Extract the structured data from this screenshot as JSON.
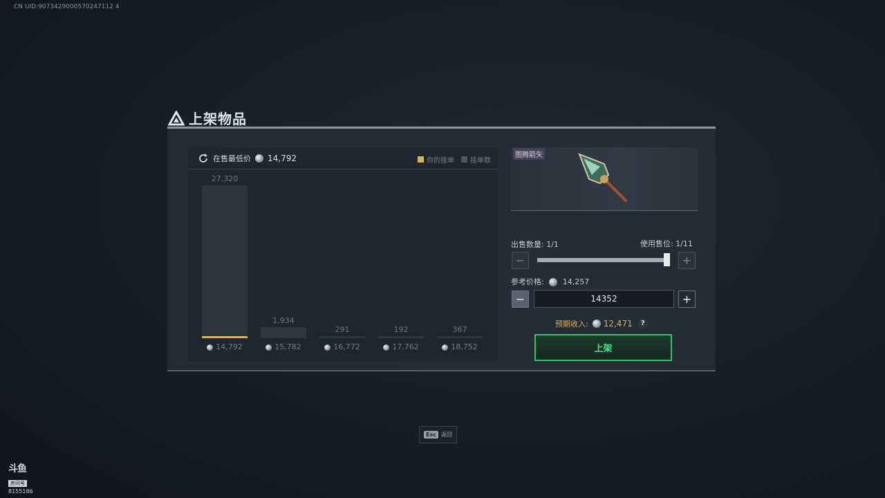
{
  "uid": "CN UID:9073429000570247112 4",
  "dialog": {
    "title": "上架物品",
    "chart": {
      "lowest_label": "在售最低价",
      "lowest_price": "14,792",
      "legend_mine": "你的挂单",
      "legend_count": "挂单数"
    },
    "item": {
      "name": "图腾箭矢",
      "icon": "arrow-icon"
    },
    "quantity_label": "出售数量:",
    "quantity_value": "1/1",
    "slots_label": "使用售位:",
    "slots_value": "1/11",
    "ref_price_label": "参考价格:",
    "ref_price_value": "14,257",
    "price_input": "14352",
    "minus": "−",
    "plus": "+",
    "income_label": "预期收入:",
    "income_value": "12,471",
    "help": "?",
    "list_button": "上架"
  },
  "footer": {
    "esc_key": "Esc",
    "esc_label": "返回"
  },
  "watermark": {
    "logo": "斗鱼",
    "tag": "房间号",
    "room": "8155186"
  },
  "chart_data": {
    "type": "bar",
    "categories": [
      "14,792",
      "15,782",
      "16,772",
      "17,762",
      "18,752"
    ],
    "values": [
      27320,
      1934,
      291,
      192,
      367
    ],
    "labels": [
      "27,320",
      "1,934",
      "291",
      "192",
      "367"
    ],
    "mine_index": 0,
    "colors": {
      "mine": "#d9b35a",
      "bar": "#2f3740"
    }
  }
}
